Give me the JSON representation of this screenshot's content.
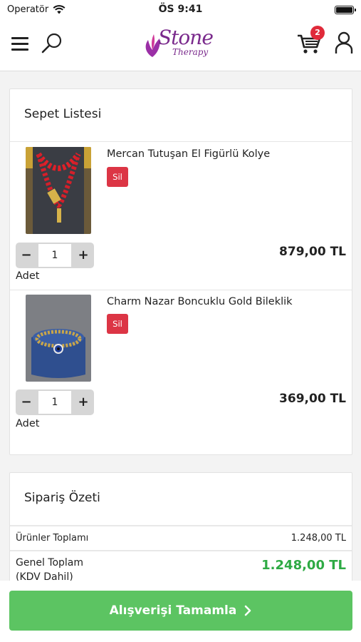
{
  "status_bar": {
    "carrier": "Operatör",
    "time": "ÖS 9:41"
  },
  "header": {
    "logo_main": "Stone",
    "logo_sub": "Therapy",
    "cart_count": "2"
  },
  "cart": {
    "title": "Sepet Listesi",
    "items": [
      {
        "name": "Mercan Tutuşan El Figürlü Kolye",
        "delete_label": "Sil",
        "quantity": "1",
        "quantity_label": "Adet",
        "price": "879,00 TL"
      },
      {
        "name": "Charm Nazar Boncuklu Gold Bileklik",
        "delete_label": "Sil",
        "quantity": "1",
        "quantity_label": "Adet",
        "price": "369,00 TL"
      }
    ],
    "minus": "−",
    "plus": "+"
  },
  "summary": {
    "title": "Sipariş Özeti",
    "subtotal_label": "Ürünler Toplamı",
    "subtotal_value": "1.248,00 TL",
    "total_label": "Genel Toplam",
    "total_note": "(KDV Dahil)",
    "total_value": "1.248,00 TL"
  },
  "checkout": {
    "label": "Alışverişi Tamamla"
  },
  "colors": {
    "accent_green": "#5cc462",
    "total_green": "#2eaa44",
    "delete_red": "#dc3545",
    "badge_red": "#e02a3a",
    "brand_purple": "#7a2a8c"
  }
}
